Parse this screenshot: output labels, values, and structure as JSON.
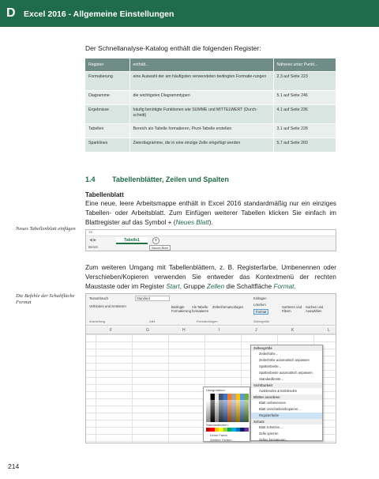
{
  "header": {
    "chapter": "D",
    "title": "Excel 2016 - Allgemeine Einstellungen"
  },
  "intro": "Der Schnellanalyse-Katalog enthält die folgenden Register:",
  "table": {
    "headers": [
      "Register",
      "enthält...",
      "Näheres unter Punkt..."
    ],
    "rows": [
      [
        "Formatierung",
        "eine Auswahl der am häufigsten verwendeten bedingten Formatie-rungen",
        "2.3 auf Seite 223"
      ],
      [
        "Diagramme",
        "die wichtigsten Diagrammtypen",
        "5.1 auf Seite 246"
      ],
      [
        "Ergebnisse",
        "häufig benötigte Funktionen wie SUMME und MITTELWERT (Durch-schnitt)",
        "4.1 auf Seite 236"
      ],
      [
        "Tabellen",
        "Bereich als Tabelle formatieren, Pivot-Tabelle erstellen",
        "3.1 auf Seite 228"
      ],
      [
        "Sparklines",
        "Zwerdiagramme, die in eine einzige Zelle eingefügt werden",
        "5.7 auf Seite 260"
      ]
    ]
  },
  "section": {
    "number": "1.4",
    "title": "Tabellenblätter, Zeilen und Spalten"
  },
  "subhead": "Tabellenblatt",
  "para1": {
    "text": "Eine neue, leere Arbeitsmappe enthält in Excel 2016 standardmäßig nur ein einziges Tabellen- oder Arbeitsblatt. Zum Einfügen weiterer Tabellen klicken Sie einfach im Blattregister auf das Symbol + (",
    "link": "Neues Blatt",
    "tail": ")."
  },
  "margin1": "Neues Tabellenblatt einfügen",
  "shot1": {
    "nav": "◀ ▶",
    "tab": "Tabelle1",
    "plus": "+",
    "tooltip": "Neues Blatt",
    "status": "Bereit",
    "topbar": "15"
  },
  "para2": {
    "pre": "Zum weiteren Umgang mit Tabellenblättern, z. B. Registerfarbe, Umbenennen oder Verschieben/Kopieren verwenden Sie entweder das Kontextmenü der rechten Maustaste oder im Register ",
    "link1": "Start",
    "mid": ", Gruppe ",
    "link2": "Zellen",
    "mid2": " die Schaltfläche ",
    "link3": "Format",
    "tail": "."
  },
  "margin2": "Die Befehle der Schaltfläche Format",
  "shot2": {
    "ribbon": {
      "wrap": "Textumbruch",
      "merge": "Verbinden und zentrieren",
      "numfmt": "Standard",
      "cond": "Bedingte Formatierung",
      "astable": "Als Tabelle formatieren",
      "cellstyles": "Zellenformatvorlagen",
      "insert": "Einfügen",
      "delete": "Löschen",
      "format": "Format",
      "sort": "Sortieren und Filtern",
      "find": "Suchen und Auswählen",
      "g1": "Ausrichtung",
      "g2": "Zahl",
      "g3": "Formatvorlagen",
      "g4": "Zellengröße"
    },
    "columns": [
      "F",
      "G",
      "H",
      "I",
      "J",
      "K",
      "L"
    ],
    "menu": [
      {
        "type": "header",
        "label": "Zellengröße"
      },
      {
        "type": "item",
        "label": "Zeilenhöhe..."
      },
      {
        "type": "item",
        "label": "Zeilenhöhe automatisch anpassen"
      },
      {
        "type": "item",
        "label": "Spaltenbreite..."
      },
      {
        "type": "item",
        "label": "Spaltenbreite automatisch anpassen"
      },
      {
        "type": "item",
        "label": "Standardbreite..."
      },
      {
        "type": "header",
        "label": "Sichtbarkeit"
      },
      {
        "type": "item",
        "label": "Ausblenden & Einblenden"
      },
      {
        "type": "header",
        "label": "Blätter anordnen"
      },
      {
        "type": "item",
        "label": "Blatt umbenennen"
      },
      {
        "type": "item",
        "label": "Blatt verschieben/kopieren..."
      },
      {
        "type": "item",
        "label": "Registerfarbe",
        "highlight": true
      },
      {
        "type": "header",
        "label": "Schutz"
      },
      {
        "type": "item",
        "label": "Blatt schützen..."
      },
      {
        "type": "item",
        "label": "Zelle sperren"
      },
      {
        "type": "item",
        "label": "Zellen formatieren..."
      }
    ],
    "palette": {
      "theme": "Designfarben",
      "standard": "Standardfarben",
      "nocolor": "Keine Farbe",
      "more": "Weitere Farben..."
    }
  },
  "pagenum": "214"
}
